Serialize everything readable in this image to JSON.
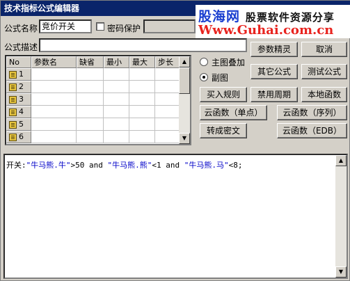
{
  "window": {
    "title": "技术指标公式编辑器"
  },
  "watermark": {
    "brand": "股海网",
    "slogan": "股票软件资源分享",
    "url": "Www.Guhai.com.cn"
  },
  "form": {
    "name_label": "公式名称",
    "name_value": "竞价开关",
    "password_label": "密码保护",
    "desc_label": "公式描述",
    "desc_value": ""
  },
  "param_table": {
    "columns": [
      "No",
      "参数名",
      "缺省",
      "最小",
      "最大",
      "步长"
    ],
    "rows": [
      "1",
      "2",
      "3",
      "4",
      "5",
      "6"
    ]
  },
  "options": {
    "main_overlay": "主图叠加",
    "sub_chart": "副图"
  },
  "buttons": {
    "param_wizard": "参数精灵",
    "cancel": "取消",
    "other_formula": "其它公式",
    "test_formula": "测试公式",
    "buy_rule": "买入规则",
    "disable_period": "禁用周期",
    "local_function": "本地函数",
    "cloud_func_single": "云函数（单点）",
    "cloud_func_series": "云函数（序列）",
    "to_cipher": "转成密文",
    "cloud_func_edb": "云函数（EDB）"
  },
  "code": {
    "t1": "开关:",
    "s1": "\"牛马熊.牛\"",
    "t2": ">50 and ",
    "s2": "\"牛马熊.熊\"",
    "t3": "<1 and ",
    "s3": "\"牛马熊.马\"",
    "t4": "<8;"
  },
  "colors": {
    "titlebar": "#0a246a",
    "brand": "#1a3fd0",
    "url": "#e8231e",
    "code_string": "#0000c8"
  }
}
